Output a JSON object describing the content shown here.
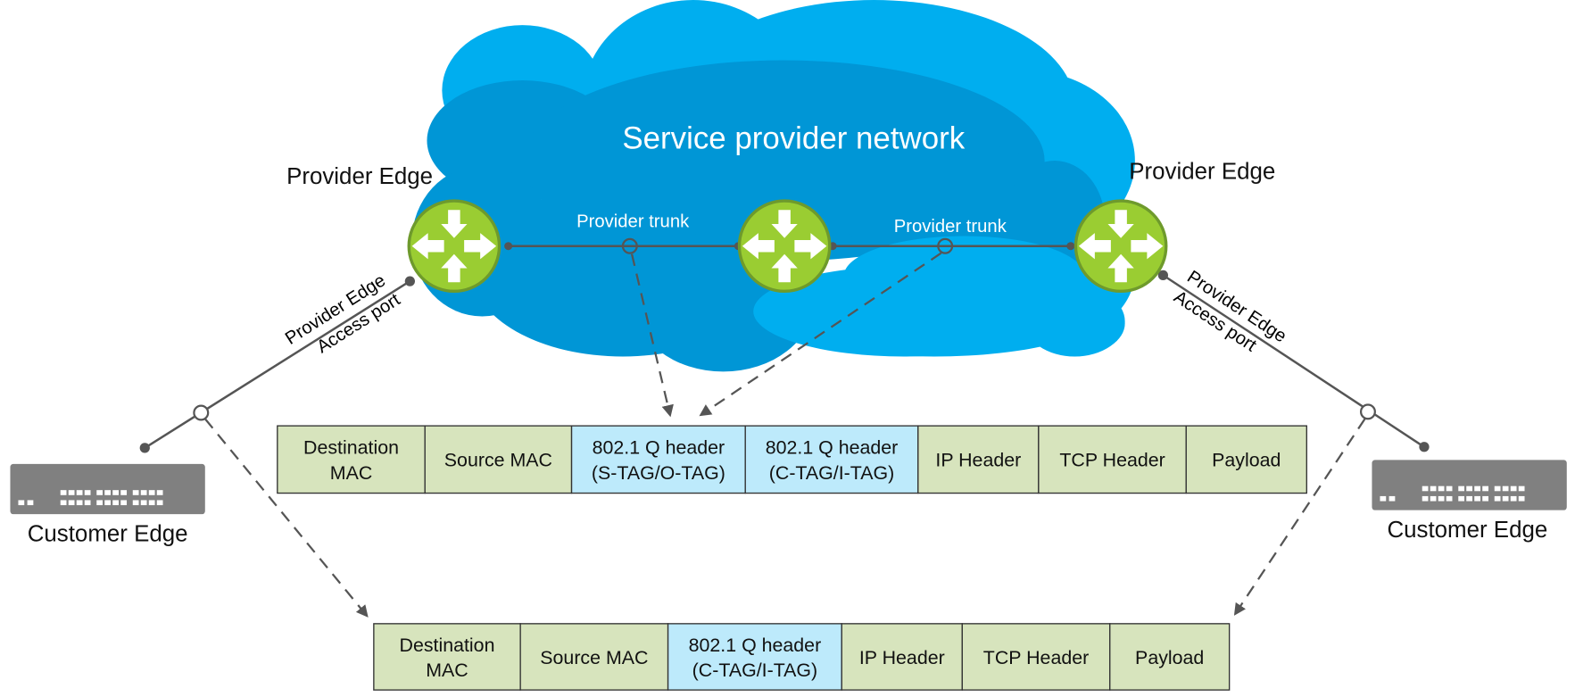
{
  "cloud": {
    "title": "Service provider network",
    "colors": {
      "light": "#00aeef",
      "dark": "#0096d6"
    }
  },
  "provider_edges": [
    {
      "label": "Provider Edge"
    },
    {
      "label": "Provider Edge"
    }
  ],
  "trunks": [
    {
      "label": "Provider trunk"
    },
    {
      "label": "Provider trunk"
    }
  ],
  "access_links": [
    {
      "line1": "Provider Edge",
      "line2": "Access port"
    },
    {
      "line1": "Provider Edge",
      "line2": "Access port"
    }
  ],
  "customer_edges": [
    {
      "label": "Customer Edge"
    },
    {
      "label": "Customer Edge"
    }
  ],
  "router_color": "#9acd32",
  "frames": {
    "colors": {
      "field": "#d7e4bd",
      "tag": "#bdeafb"
    },
    "provider_frame": [
      {
        "lines": [
          "Destination",
          "MAC"
        ],
        "type": "field"
      },
      {
        "lines": [
          "Source MAC"
        ],
        "type": "field"
      },
      {
        "lines": [
          "802.1 Q header",
          "(S-TAG/O-TAG)"
        ],
        "type": "tag"
      },
      {
        "lines": [
          "802.1 Q header",
          "(C-TAG/I-TAG)"
        ],
        "type": "tag"
      },
      {
        "lines": [
          "IP Header"
        ],
        "type": "field"
      },
      {
        "lines": [
          "TCP Header"
        ],
        "type": "field"
      },
      {
        "lines": [
          "Payload"
        ],
        "type": "field"
      }
    ],
    "customer_frame": [
      {
        "lines": [
          "Destination",
          "MAC"
        ],
        "type": "field"
      },
      {
        "lines": [
          "Source MAC"
        ],
        "type": "field"
      },
      {
        "lines": [
          "802.1 Q header",
          "(C-TAG/I-TAG)"
        ],
        "type": "tag"
      },
      {
        "lines": [
          "IP Header"
        ],
        "type": "field"
      },
      {
        "lines": [
          "TCP Header"
        ],
        "type": "field"
      },
      {
        "lines": [
          "Payload"
        ],
        "type": "field"
      }
    ]
  }
}
